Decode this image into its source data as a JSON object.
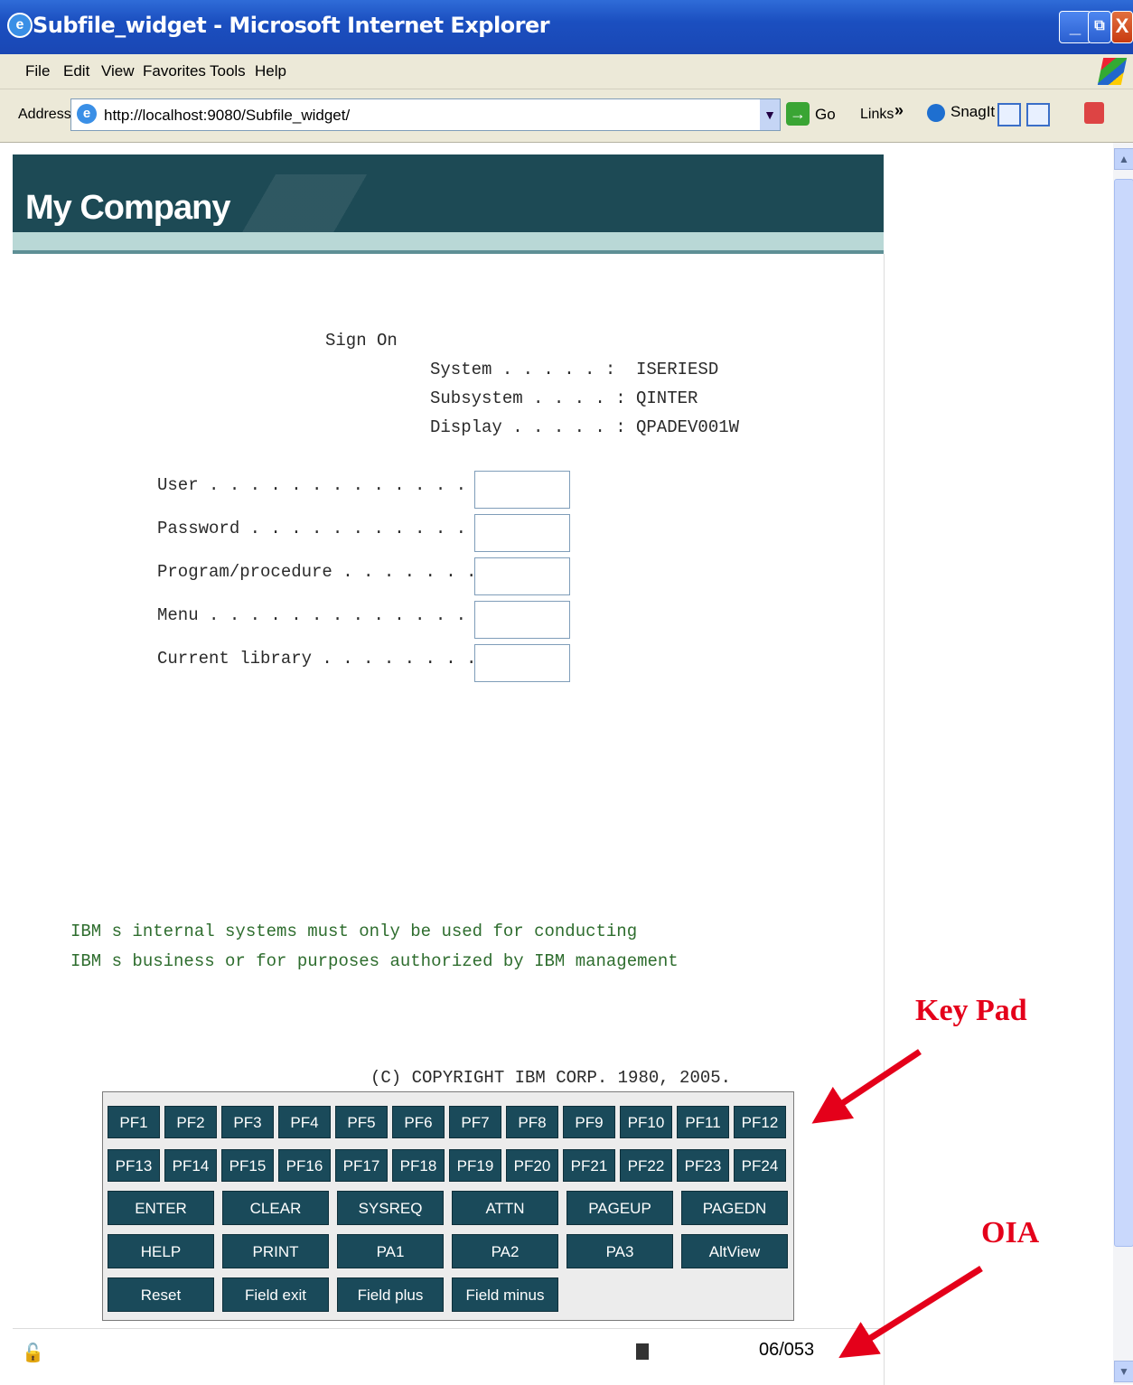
{
  "window": {
    "title": "Subfile_widget - Microsoft Internet Explorer",
    "minimize": "_",
    "restore": "⧉",
    "close": "X"
  },
  "menu": [
    "File",
    "Edit",
    "View",
    "Favorites",
    "Tools",
    "Help"
  ],
  "address_bar": {
    "label": "Address",
    "url": "http://localhost:9080/Subfile_widget/",
    "go_label": "Go",
    "links_label": "Links",
    "snagit_label": "SnagIt"
  },
  "banner": {
    "title": "My Company"
  },
  "signon": {
    "title": "Sign On",
    "info": [
      {
        "label": "System . . . . . :",
        "value": "ISERIESD"
      },
      {
        "label": "Subsystem . . . . :",
        "value": "QINTER"
      },
      {
        "label": "Display . . . . . :",
        "value": "QPADEV001W"
      }
    ],
    "fields": [
      {
        "label": "User . . . . . . . . . . . . . .",
        "value": ""
      },
      {
        "label": "Password . . . . . . . . . . . .",
        "value": ""
      },
      {
        "label": "Program/procedure . . . . . . . .",
        "value": ""
      },
      {
        "label": "Menu . . . . . . . . . . . . . .",
        "value": ""
      },
      {
        "label": "Current library . . . . . . . . .",
        "value": ""
      }
    ],
    "notice_line1": "IBM s internal systems must only be used for conducting",
    "notice_line2": "IBM s business or for purposes authorized by IBM management",
    "copyright": "(C) COPYRIGHT IBM CORP. 1980, 2005."
  },
  "keypad": {
    "pf_row1": [
      "PF1",
      "PF2",
      "PF3",
      "PF4",
      "PF5",
      "PF6",
      "PF7",
      "PF8",
      "PF9",
      "PF10",
      "PF11",
      "PF12"
    ],
    "pf_row2": [
      "PF13",
      "PF14",
      "PF15",
      "PF16",
      "PF17",
      "PF18",
      "PF19",
      "PF20",
      "PF21",
      "PF22",
      "PF23",
      "PF24"
    ],
    "row3": [
      "ENTER",
      "CLEAR",
      "SYSREQ",
      "ATTN",
      "PAGEUP",
      "PAGEDN"
    ],
    "row4": [
      "HELP",
      "PRINT",
      "PA1",
      "PA2",
      "PA3",
      "AltView"
    ],
    "row5": [
      "Reset",
      "Field exit",
      "Field plus",
      "Field minus"
    ]
  },
  "annotations": {
    "keypad": "Key Pad",
    "oia": "OIA"
  },
  "oia": {
    "cursor_position": "06/053"
  },
  "colors": {
    "banner": "#1d4a55",
    "key": "#1a4a5a",
    "annotation": "#e4001a",
    "signon_notice": "#2e6d2e"
  }
}
